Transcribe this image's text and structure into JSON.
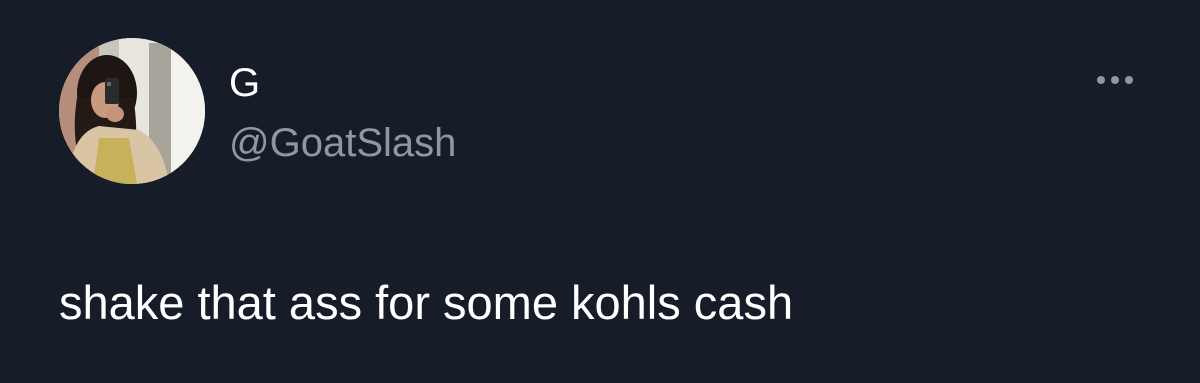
{
  "tweet": {
    "display_name": "G",
    "handle": "@GoatSlash",
    "text": "shake that ass for some kohls cash",
    "more_icon": "more-horizontal-icon",
    "avatar_icon": "profile-photo"
  },
  "colors": {
    "background": "#161d29",
    "primary_text": "#ffffff",
    "secondary_text": "#8b98a5"
  }
}
